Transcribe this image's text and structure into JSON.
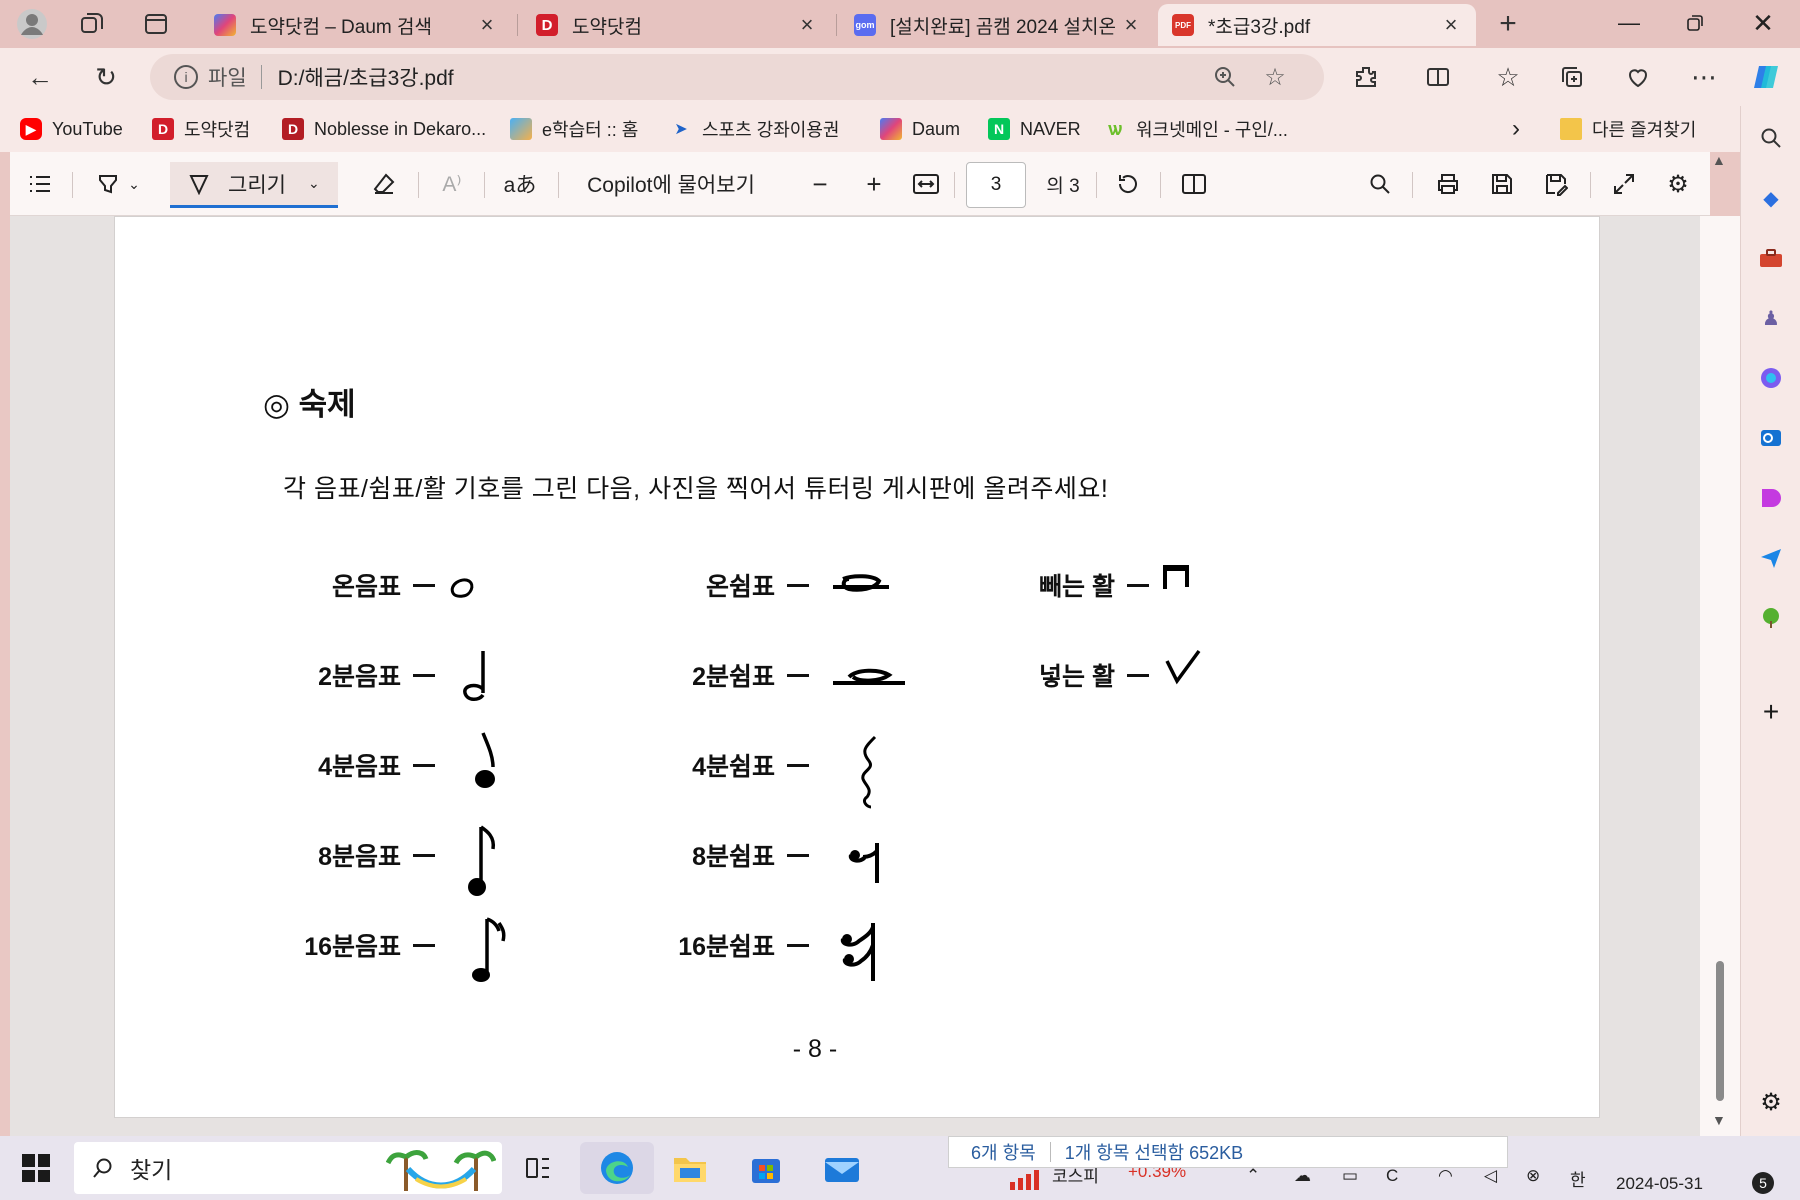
{
  "tabs": [
    {
      "title": "도약닷컴 – Daum 검색",
      "active": false
    },
    {
      "title": "도약닷컴",
      "active": false
    },
    {
      "title": "[설치완료] 곰캠 2024 설치온",
      "active": false
    },
    {
      "title": "*초급3강.pdf",
      "active": true
    }
  ],
  "favicon_text": {
    "daum": "D",
    "doyak": "D",
    "gom": "gom",
    "pdf": "PDF"
  },
  "address": {
    "protocol": "파일",
    "url": "D:/해금/초급3강.pdf"
  },
  "favorites": [
    {
      "label": "YouTube",
      "icon": "youtube-icon"
    },
    {
      "label": "도약닷컴",
      "icon": "doyak-icon"
    },
    {
      "label": "Noblesse in Dekaro...",
      "icon": "dekaro-icon"
    },
    {
      "label": "e학습터 :: 홈",
      "icon": "elearning-icon"
    },
    {
      "label": "스포츠 강좌이용권",
      "icon": "sports-icon"
    },
    {
      "label": "Daum",
      "icon": "daum-icon"
    },
    {
      "label": "NAVER",
      "icon": "naver-icon"
    },
    {
      "label": "워크넷메인 - 구인/...",
      "icon": "worknet-icon"
    }
  ],
  "favorites_more": "다른 즐겨찾기",
  "pdf_toolbar": {
    "draw_label": "그리기",
    "text_icon_label": "aあ",
    "copilot_label": "Copilot에 물어보기",
    "current_page": "3",
    "total_pages": "의 3"
  },
  "document": {
    "heading": "◎ 숙제",
    "instruction": "각 음표/쉼표/활 기호를 그린 다음, 사진을 찍어서 튜터링 게시판에 올려주세요!",
    "notes": [
      "온음표",
      "2분음표",
      "4분음표",
      "8분음표",
      "16분음표"
    ],
    "rests": [
      "온쉼표",
      "2분쉼표",
      "4분쉼표",
      "8분쉼표",
      "16분쉼표"
    ],
    "bows": [
      "빼는 활",
      "넣는 활"
    ],
    "page_number": "- 8 -"
  },
  "taskbar": {
    "search_placeholder": "찾기",
    "explorer_status": {
      "count": "6개 항목",
      "selected": "1개 항목 선택함 652KB"
    },
    "stock": {
      "name": "코스피",
      "change": "+0.39%"
    },
    "date": "2024-05-31",
    "notification_count": "5"
  },
  "colors": {
    "tab_strip": "#e6c3c0",
    "toolbar": "#f7e9e7",
    "accent": "#1f6fd1",
    "stock_up": "#d93025"
  }
}
